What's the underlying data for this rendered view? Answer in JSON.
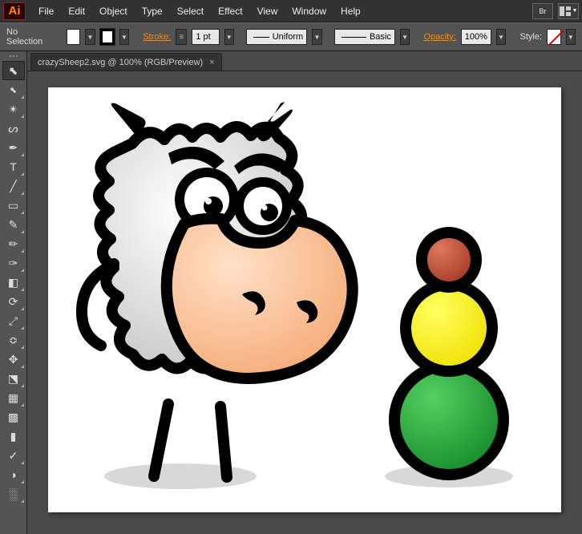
{
  "menu": {
    "items": [
      "File",
      "Edit",
      "Object",
      "Type",
      "Select",
      "Effect",
      "View",
      "Window",
      "Help"
    ],
    "br": "Br"
  },
  "control": {
    "selection": "No Selection",
    "stroke_label": "Stroke:",
    "stroke_value": "1 pt",
    "profile": "Uniform",
    "brush": "Basic",
    "opacity_label": "Opacity:",
    "opacity_value": "100%",
    "style_label": "Style:"
  },
  "tools": [
    {
      "name": "selection-tool",
      "glyph": "⬉",
      "selected": true,
      "tri": false
    },
    {
      "name": "direct-selection-tool",
      "glyph": "⬉",
      "selected": false,
      "tri": true,
      "small": true
    },
    {
      "name": "magic-wand-tool",
      "glyph": "✴",
      "selected": false,
      "tri": true
    },
    {
      "name": "lasso-tool",
      "glyph": "ᔕ",
      "selected": false,
      "tri": false
    },
    {
      "name": "pen-tool",
      "glyph": "✒",
      "selected": false,
      "tri": true
    },
    {
      "name": "type-tool",
      "glyph": "T",
      "selected": false,
      "tri": true
    },
    {
      "name": "line-tool",
      "glyph": "╱",
      "selected": false,
      "tri": true
    },
    {
      "name": "rectangle-tool",
      "glyph": "▭",
      "selected": false,
      "tri": true
    },
    {
      "name": "paintbrush-tool",
      "glyph": "✎",
      "selected": false,
      "tri": true
    },
    {
      "name": "pencil-tool",
      "glyph": "✏",
      "selected": false,
      "tri": true
    },
    {
      "name": "blob-brush-tool",
      "glyph": "✑",
      "selected": false,
      "tri": true
    },
    {
      "name": "eraser-tool",
      "glyph": "◧",
      "selected": false,
      "tri": true
    },
    {
      "name": "rotate-tool",
      "glyph": "⟳",
      "selected": false,
      "tri": true
    },
    {
      "name": "scale-tool",
      "glyph": "⤢",
      "selected": false,
      "tri": true
    },
    {
      "name": "width-tool",
      "glyph": "≎",
      "selected": false,
      "tri": true
    },
    {
      "name": "free-transform-tool",
      "glyph": "✥",
      "selected": false,
      "tri": true
    },
    {
      "name": "shape-builder-tool",
      "glyph": "⬔",
      "selected": false,
      "tri": true
    },
    {
      "name": "perspective-tool",
      "glyph": "▦",
      "selected": false,
      "tri": true
    },
    {
      "name": "mesh-tool",
      "glyph": "▩",
      "selected": false,
      "tri": false
    },
    {
      "name": "gradient-tool",
      "glyph": "▮",
      "selected": false,
      "tri": false
    },
    {
      "name": "eyedropper-tool",
      "glyph": "✓",
      "selected": false,
      "tri": true
    },
    {
      "name": "blend-tool",
      "glyph": "◑",
      "selected": false,
      "tri": true
    },
    {
      "name": "symbol-sprayer-tool",
      "glyph": "░",
      "selected": false,
      "tri": true
    }
  ],
  "tab": {
    "label": "crazySheep2.svg @ 100% (RGB/Preview)",
    "close": "×"
  }
}
